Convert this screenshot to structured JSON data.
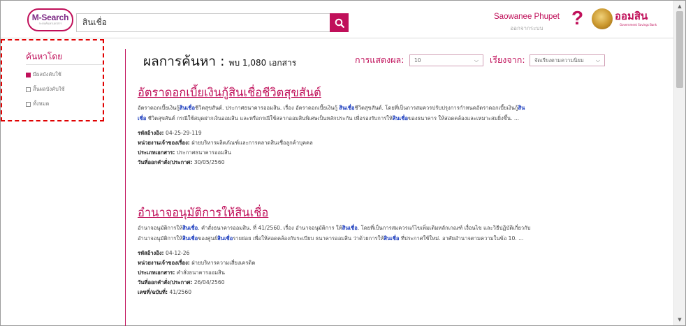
{
  "header": {
    "logo_text": "M-Search",
    "logo_sub": "ระบบค้นหาเอกสาร",
    "search_value": "สินเชื่อ",
    "user_name": "Saowanee Phupet",
    "logout_label": "ออกจากระบบ",
    "help_label": "?",
    "org_name": "ออมสิน",
    "org_sub": "Government Savings Bank"
  },
  "sidebar": {
    "title": "ค้นหาโดย",
    "filters": [
      {
        "label": "มีผลบังคับใช้",
        "checked": true
      },
      {
        "label": "สิ้นผลบังคับใช้",
        "checked": false
      },
      {
        "label": "ทั้งหมด",
        "checked": false
      }
    ]
  },
  "results_header": {
    "title": "ผลการค้นหา :",
    "count": "พบ 1,080 เอกสาร",
    "display_label": "การแสดงผล:",
    "display_value": "10",
    "sort_label": "เรียงจาก:",
    "sort_value": "จัดเรียงตามความนิยม"
  },
  "results": [
    {
      "title": "อัตราดอกเบี้ยเงินกู้สินเชื่อชีวิตสุขสันต์",
      "snippet_parts": [
        {
          "t": "อัตราดอกเบี้ยเงินกู้"
        },
        {
          "t": "สินเชื่อ",
          "hl": true
        },
        {
          "t": "ชีวิตสุขสันต์. ประกาศธนาคารออมสิน. เรื่อง อัตราดอกเบี้ยเงินกู้ "
        },
        {
          "t": "สินเชื่อ",
          "hl": true
        },
        {
          "t": "ชีวิตสุขสันต์. โดยที่เป็นการสมควรปรับปรุงการกำหนดอัตราดอกเบี้ยเงินกู้"
        },
        {
          "t": "สินเชื่อ",
          "hl": true
        },
        {
          "t": " ชีวิตสุขสันต์ กรณีใช้สมุดฝากเงินออมสิน และหรือกรณีใช้สลากออมสินพิเศษเป็นหลักประกัน เพื่อรองรับการให้"
        },
        {
          "t": "สินเชื่อ",
          "hl": true
        },
        {
          "t": "ของธนาคาร ให้สอดคล้องและเหมาะสมยิ่งขึ้น. ..."
        }
      ],
      "meta": [
        {
          "label": "รหัสอ้างอิง:",
          "value": "04-25-29-119"
        },
        {
          "label": "หน่วยงานเจ้าของเรื่อง:",
          "value": "ฝ่ายบริหารผลิตภัณฑ์และการตลาดสินเชื่อลูกค้าบุคคล"
        },
        {
          "label": "ประเภทเอกสาร:",
          "value": "ประกาศธนาคารออมสิน"
        },
        {
          "label": "วันที่ออกคำสั่ง/ประกาศ:",
          "value": "30/05/2560"
        }
      ]
    },
    {
      "title": "อำนาจอนุมัติการให้สินเชื่อ",
      "snippet_parts": [
        {
          "t": "อำนาจอนุมัติการให้"
        },
        {
          "t": "สินเชื่อ",
          "hl": true
        },
        {
          "t": ". คำสั่งธนาคารออมสิน. ที่ 41/2560. เรื่อง อำนาจอนุมัติการ ให้"
        },
        {
          "t": "สินเชื่อ",
          "hl": true
        },
        {
          "t": ". โดยที่เป็นการสมควรแก้ไขเพิ่มเติมหลักเกณฑ์ เงื่อนไข และวิธีปฏิบัติเกี่ยวกับ อำนาจอนุมัติการให้"
        },
        {
          "t": "สินเชื่อ",
          "hl": true
        },
        {
          "t": "ของศูนย์"
        },
        {
          "t": "สินเชื่อ",
          "hl": true
        },
        {
          "t": "รายย่อย เพื่อให้สอดคล้องกับระเบียบ ธนาคารออมสิน ว่าด้วยการให้"
        },
        {
          "t": "สินเชื่อ",
          "hl": true
        },
        {
          "t": " ที่ประกาศใช้ใหม่. อาศัยอำนาจตามความในข้อ 10. ..."
        }
      ],
      "meta": [
        {
          "label": "รหัสอ้างอิง:",
          "value": "04-12-26"
        },
        {
          "label": "หน่วยงานเจ้าของเรื่อง:",
          "value": "ฝ่ายบริหารความเสี่ยงเครดิต"
        },
        {
          "label": "ประเภทเอกสาร:",
          "value": "คำสั่งธนาคารออมสิน"
        },
        {
          "label": "วันที่ออกคำสั่ง/ประกาศ:",
          "value": "26/04/2560"
        },
        {
          "label": "เลขที่/ฉบับที่:",
          "value": "41/2560"
        }
      ]
    }
  ],
  "colors": {
    "accent": "#c0105a",
    "highlight": "#1a3bbd",
    "sidebar_border": "#e00000"
  },
  "icons": [
    "search-icon",
    "help-icon",
    "org-logo-icon",
    "chevron-down-icon",
    "scroll-up-icon",
    "scroll-down-icon"
  ]
}
